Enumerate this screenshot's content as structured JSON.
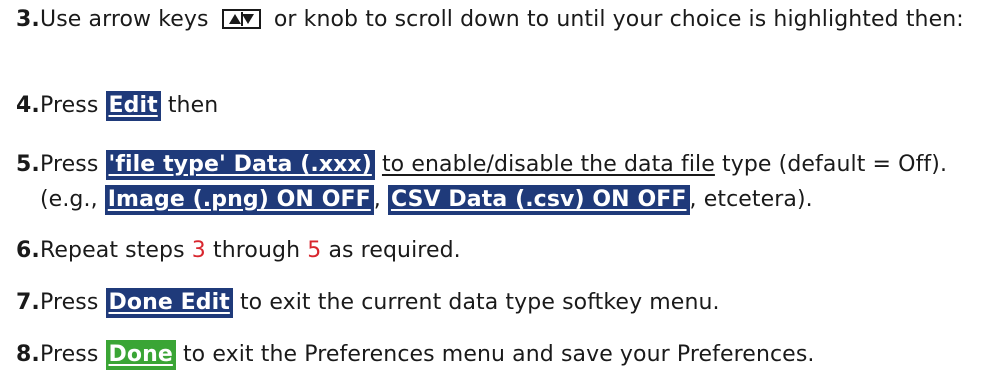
{
  "steps": [
    {
      "num": "3.",
      "text_a": "Use arrow keys",
      "text_b": "or knob to scroll down to until your choice is highlighted then:"
    },
    {
      "num": "4.",
      "pre": "Press",
      "key": "Edit",
      "post": "then"
    },
    {
      "num": "5.",
      "pre": "Press",
      "key": "'file type' Data (.xxx)",
      "mid_ul": "to enable/disable the data file",
      "post": "type (default = Off). (e.g.,",
      "key2": "Image (.png) ON OFF",
      "sep": ",",
      "key3": "CSV Data (.csv) ON OFF",
      "tail": ", etcetera)."
    },
    {
      "num": "6.",
      "pre": "Repeat steps",
      "ref1": "3",
      "mid": "through",
      "ref2": "5",
      "post": "as required."
    },
    {
      "num": "7.",
      "pre": "Press",
      "key": "Done Edit",
      "post": "to exit the current data type softkey menu."
    },
    {
      "num": "8.",
      "pre": "Press",
      "key": "Done",
      "post": "to exit the Preferences menu and save your Preferences."
    }
  ],
  "icons": {
    "arrow_keys": "up-down-arrow-keys-icon"
  },
  "colors": {
    "softkey_blue": "#1f3a7a",
    "softkey_green": "#3aa535",
    "step_ref_red": "#d8262e"
  }
}
